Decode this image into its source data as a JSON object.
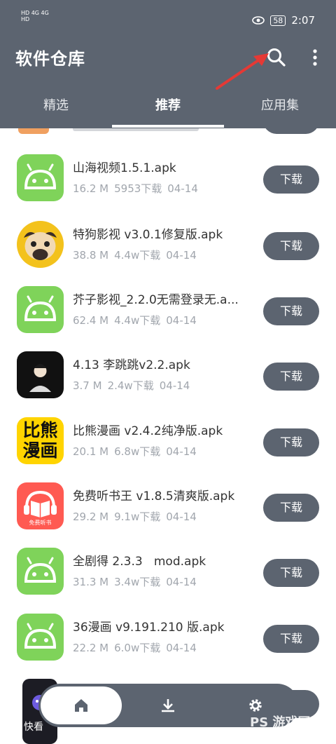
{
  "status_bar": {
    "left_line1": "HD 4G 4G",
    "left_line2": "HD",
    "battery": "58",
    "time": "2:07"
  },
  "app_bar": {
    "title": "软件仓库",
    "search_icon": "search-icon",
    "more_icon": "more-vert-icon"
  },
  "tabs": [
    {
      "label": "精选",
      "active": false
    },
    {
      "label": "推荐",
      "active": true
    },
    {
      "label": "应用集",
      "active": false
    }
  ],
  "apps": [
    {
      "name": "山海视频1.5.1.apk",
      "size": "16.2 M",
      "downloads": "5953下载",
      "date": "04-14",
      "icon": "android-icon",
      "button": "下载"
    },
    {
      "name": "特狗影视 v3.0.1修复版.apk",
      "size": "38.8 M",
      "downloads": "4.4w下载",
      "date": "04-14",
      "icon": "pug-icon",
      "button": "下载"
    },
    {
      "name": "芥子影视_2.2.0无需登录无.a...",
      "size": "62.4 M",
      "downloads": "4.4w下载",
      "date": "04-14",
      "icon": "android-icon",
      "button": "下载"
    },
    {
      "name": "4.13 李跳跳v2.2.apk",
      "size": "3.7 M",
      "downloads": "2.4w下载",
      "date": "04-14",
      "icon": "avatar-icon",
      "button": "下载"
    },
    {
      "name": "比熊漫画 v2.4.2纯净版.apk",
      "size": "20.1 M",
      "downloads": "6.8w下载",
      "date": "04-14",
      "icon": "bixiong-icon",
      "icon_text": "比熊漫画",
      "button": "下载"
    },
    {
      "name": "免费听书王 v1.8.5清爽版.apk",
      "size": "29.2 M",
      "downloads": "9.1w下载",
      "date": "04-14",
      "icon": "book-headphone-icon",
      "icon_text": "免费听书",
      "button": "下载"
    },
    {
      "name": "全剧得 2.3.3   mod.apk",
      "size": "31.3 M",
      "downloads": "3.4w下载",
      "date": "04-14",
      "icon": "android-icon",
      "button": "下载"
    },
    {
      "name": "36漫画 v9.191.210 版.apk",
      "size": "22.2 M",
      "downloads": "6.0w下载",
      "date": "04-14",
      "icon": "android-icon",
      "button": "下载"
    }
  ],
  "partial_bottom_icon_text": "快看",
  "bottom_nav": [
    {
      "icon": "home-icon",
      "active": true
    },
    {
      "icon": "download-icon",
      "active": false
    },
    {
      "icon": "settings-icon",
      "active": false
    }
  ],
  "watermark": "PS 游戏网",
  "colors": {
    "header": "#5c6470",
    "button": "#5c6470",
    "android_green": "#7fd35a",
    "arrow": "#e53935"
  }
}
